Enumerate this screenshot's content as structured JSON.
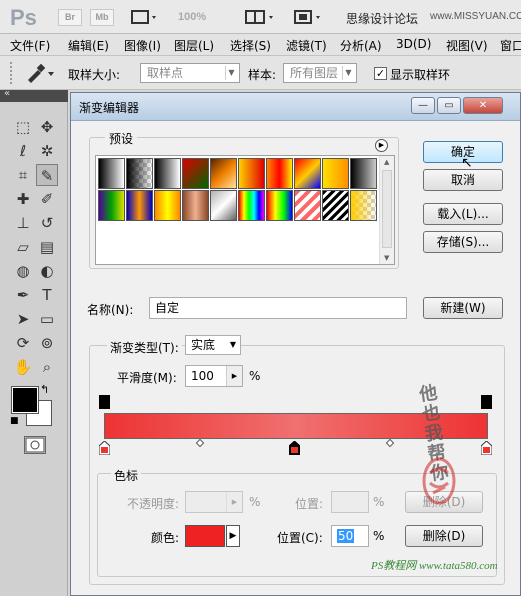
{
  "app": {
    "logo": "Ps",
    "buttons": [
      "Br",
      "Mb"
    ],
    "zoom": "100%",
    "site_name": "思缘设计论坛",
    "site_url": "www.MISSYUAN.COM"
  },
  "menubar": [
    "文件(F)",
    "编辑(E)",
    "图像(I)",
    "图层(L)",
    "选择(S)",
    "滤镜(T)",
    "分析(A)",
    "3D(D)",
    "视图(V)",
    "窗口"
  ],
  "options": {
    "sample_size_label": "取样大小:",
    "sample_size_value": "取样点",
    "sample_label": "样本:",
    "sample_value": "所有图层",
    "show_ring_label": "显示取样环",
    "show_ring_checked": true
  },
  "tools": [
    "marquee-icon",
    "move-icon",
    "lasso-icon",
    "magic-wand-icon",
    "crop-icon",
    "eyedropper-icon",
    "healing-icon",
    "brush-icon",
    "stamp-icon",
    "history-brush-icon",
    "eraser-icon",
    "gradient-icon",
    "blur-icon",
    "dodge-icon",
    "pen-icon",
    "type-icon",
    "path-select-icon",
    "shape-icon",
    "3d-rotate-icon",
    "3d-orbit-icon",
    "hand-icon",
    "zoom-icon"
  ],
  "colors": {
    "foreground": "#000000",
    "background": "#ffffff"
  },
  "dialog": {
    "title": "渐变编辑器",
    "presets_label": "预设",
    "ok": "确定",
    "cancel": "取消",
    "load": "载入(L)...",
    "save": "存储(S)...",
    "name_label": "名称(N):",
    "name_value": "自定",
    "new": "新建(W)",
    "gradient_type_label": "渐变类型(T):",
    "gradient_type_value": "实底",
    "smoothness_label": "平滑度(M):",
    "smoothness_value": "100",
    "percent": "%",
    "stops_label": "色标",
    "opacity_label": "不透明度:",
    "position_label_top": "位置:",
    "delete_top": "删除(D)",
    "color_label": "颜色:",
    "color_value": "#ee2222",
    "position_label": "位置(C):",
    "position_value": "50",
    "delete": "删除(D)"
  },
  "presets": [
    "linear-gradient(90deg,#000,#fff)",
    "linear-gradient(90deg,#000,rgba(0,0,0,0))",
    "linear-gradient(90deg,#000,#fff)",
    "linear-gradient(135deg,#d00,#060)",
    "linear-gradient(135deg,#5a2400,#f08000,#ffe0a0)",
    "linear-gradient(90deg,#ffd000,#e00000)",
    "linear-gradient(90deg,#ff8800,#ff0000,#ffee00)",
    "linear-gradient(135deg,#ff0000,#ffcc00,#0000ff)",
    "linear-gradient(90deg,#ffe000,#ff9000)",
    "linear-gradient(90deg,#000,#ccc)",
    "linear-gradient(90deg,#5000a0,#00a000,#e0e000)",
    "linear-gradient(90deg,#0000c0,#ff9900,#0000c0)",
    "linear-gradient(90deg,#ff8800,#ffff00,#ff8800)",
    "linear-gradient(90deg,#8a4a2a,#f0b090,#8a4a2a)",
    "linear-gradient(135deg,#b0b0b0,#ffffff,#606060)",
    "linear-gradient(90deg,#ff0000,#ffff00,#00ff00,#00ffff,#0000ff,#ff00ff)",
    "linear-gradient(90deg,#ff0000,#ffff00,#00ff00,#0000ff)",
    "repeating-linear-gradient(135deg,#ff6666 0 4px,#ffffff 4px 8px)",
    "repeating-linear-gradient(135deg,#000 0 3px,#fff 3px 6px)",
    "linear-gradient(90deg,#ffcc00,rgba(255,204,0,0))"
  ],
  "gradient_bar": {
    "left_color": "#ee3333",
    "mid_color": "#f07070",
    "right_color": "#ee3333",
    "stops_count_top": 2,
    "stops_count_bottom": 3
  },
  "watermark": {
    "handwriting": "他 也 我 帮 你",
    "url": "PS教程网 www.tata580.com"
  }
}
